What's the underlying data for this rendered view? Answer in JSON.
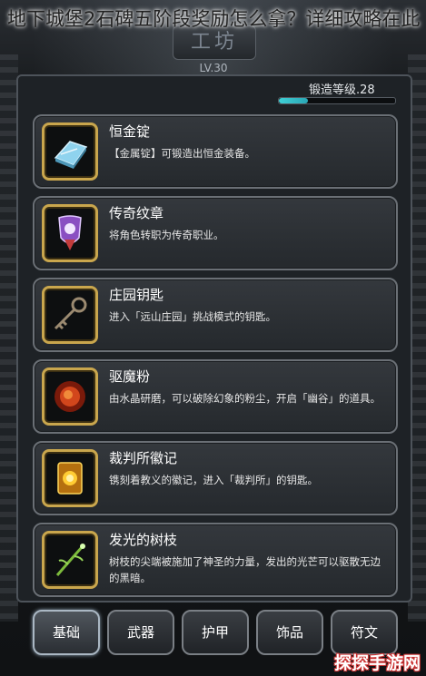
{
  "caption": "地下城堡2石碑五阶段奖励怎么拿？详细攻略在此",
  "header": {
    "title": "工坊",
    "level": "LV.30"
  },
  "forge": {
    "label": "锻造等级.28",
    "progress": 0.25,
    "fill_color": "#3fd0d6"
  },
  "items": [
    {
      "name": "恒金锭",
      "desc": "【金属锭】可锻造出恒金装备。",
      "icon": "ingot-icon"
    },
    {
      "name": "传奇纹章",
      "desc": "将角色转职为传奇职业。",
      "icon": "crest-icon"
    },
    {
      "name": "庄园钥匙",
      "desc": "进入「远山庄园」挑战模式的钥匙。",
      "icon": "key-icon"
    },
    {
      "name": "驱魔粉",
      "desc": "由水晶研磨，可以破除幻象的粉尘，开启「幽谷」的道具。",
      "icon": "powder-icon"
    },
    {
      "name": "裁判所徽记",
      "desc": "镌刻着教义的徽记，进入「裁判所」的钥匙。",
      "icon": "emblem-icon"
    },
    {
      "name": "发光的树枝",
      "desc": "树枝的尖端被施加了神圣的力量，发出的光芒可以驱散无边的黑暗。",
      "icon": "branch-icon"
    }
  ],
  "tabs": [
    {
      "label": "基础",
      "active": true
    },
    {
      "label": "武器",
      "active": false
    },
    {
      "label": "护甲",
      "active": false
    },
    {
      "label": "饰品",
      "active": false
    },
    {
      "label": "符文",
      "active": false
    }
  ],
  "watermark": "探探手游网",
  "colors": {
    "icon_border": "#c9a64d",
    "accent": "#3fd0d6"
  }
}
